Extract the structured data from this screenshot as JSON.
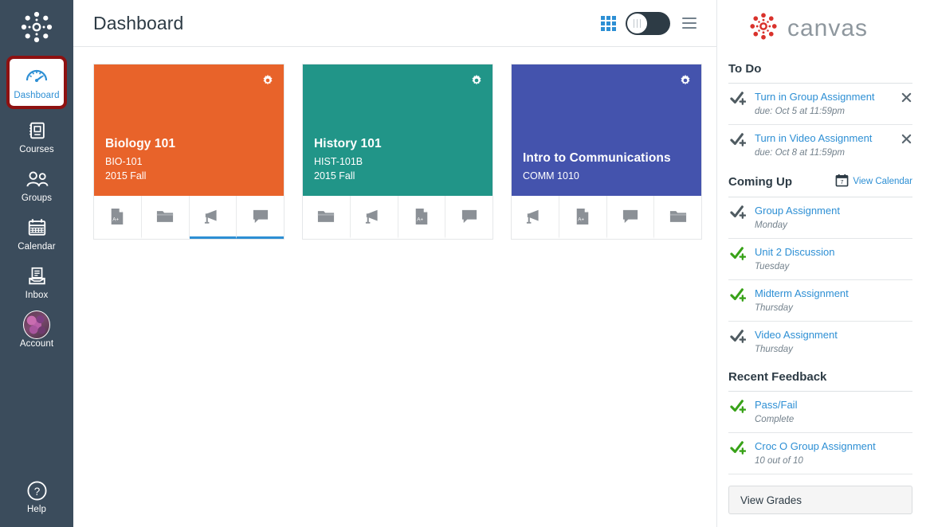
{
  "globalnav": {
    "logo_icon": "canvas-logo-icon",
    "items": [
      {
        "label": "Dashboard",
        "icon": "dashboard-gauge-icon",
        "active": true
      },
      {
        "label": "Courses",
        "icon": "courses-book-icon",
        "active": false
      },
      {
        "label": "Groups",
        "icon": "groups-people-icon",
        "active": false
      },
      {
        "label": "Calendar",
        "icon": "calendar-icon",
        "active": false
      },
      {
        "label": "Inbox",
        "icon": "inbox-tray-icon",
        "active": false
      },
      {
        "label": "Account",
        "icon": "account-avatar-icon",
        "active": false
      }
    ],
    "help": {
      "label": "Help",
      "icon": "help-question-icon"
    },
    "active_highlight_color": "#8E1111",
    "background_color": "#3B4C5C",
    "active_text_color": "#2D8FD4"
  },
  "header": {
    "title": "Dashboard",
    "grid_icon": "grid-view-icon",
    "toggle_icon": "list-view-toggle",
    "menu_icon": "hamburger-menu-icon",
    "grid_icon_color": "#2D8FD4"
  },
  "cards": [
    {
      "name": "Biology 101",
      "code": "BIO-101",
      "term": "2015 Fall",
      "color": "#E8632A",
      "gear_icon": "gear-icon",
      "actions": [
        {
          "icon": "assignments-icon",
          "active": false
        },
        {
          "icon": "files-folder-icon",
          "active": false
        },
        {
          "icon": "announcements-megaphone-icon",
          "active": true
        },
        {
          "icon": "discussions-icon",
          "active": true
        }
      ]
    },
    {
      "name": "History 101",
      "code": "HIST-101B",
      "term": "2015 Fall",
      "color": "#219588",
      "gear_icon": "gear-icon",
      "actions": [
        {
          "icon": "files-folder-icon",
          "active": false
        },
        {
          "icon": "announcements-megaphone-icon",
          "active": false
        },
        {
          "icon": "assignments-icon",
          "active": false
        },
        {
          "icon": "discussions-icon",
          "active": false
        }
      ]
    },
    {
      "name": "Intro to Communications",
      "code": "COMM 1010",
      "term": "",
      "color": "#4453AD",
      "gear_icon": "gear-icon",
      "actions": [
        {
          "icon": "announcements-megaphone-icon",
          "active": false
        },
        {
          "icon": "assignments-icon",
          "active": false
        },
        {
          "icon": "discussions-icon",
          "active": false
        },
        {
          "icon": "files-folder-icon",
          "active": false
        }
      ]
    }
  ],
  "rail": {
    "brand": {
      "word": "canvas",
      "logo_icon": "canvas-logo-icon",
      "word_color": "#8E979E",
      "logo_color": "#D9322C"
    },
    "todo": {
      "title": "To Do",
      "items": [
        {
          "link": "Turn in Group Assignment",
          "sub": "due: Oct 5 at 11:59pm",
          "icon": "assignment-check-icon",
          "icon_color": "#4F5B61",
          "close_icon": "close-icon"
        },
        {
          "link": "Turn in Video Assignment",
          "sub": "due: Oct 8 at 11:59pm",
          "icon": "assignment-check-icon",
          "icon_color": "#4F5B61",
          "close_icon": "close-icon"
        }
      ]
    },
    "coming_up": {
      "title": "Coming Up",
      "view_calendar_label": "View Calendar",
      "calendar_icon": "calendar-icon",
      "calendar_icon_day": "7",
      "items": [
        {
          "link": "Group Assignment",
          "sub": "Monday",
          "icon": "assignment-check-icon",
          "icon_color": "#4F5B61"
        },
        {
          "link": "Unit 2 Discussion",
          "sub": "Tuesday",
          "icon": "assignment-check-icon",
          "icon_color": "#38A218"
        },
        {
          "link": "Midterm Assignment",
          "sub": "Thursday",
          "icon": "assignment-check-icon",
          "icon_color": "#38A218"
        },
        {
          "link": "Video Assignment",
          "sub": "Thursday",
          "icon": "assignment-check-icon",
          "icon_color": "#4F5B61"
        }
      ]
    },
    "recent_feedback": {
      "title": "Recent Feedback",
      "items": [
        {
          "link": "Pass/Fail",
          "sub": "Complete",
          "icon": "assignment-check-icon",
          "icon_color": "#38A218"
        },
        {
          "link": "Croc O Group Assignment",
          "sub": "10 out of 10",
          "icon": "assignment-check-icon",
          "icon_color": "#38A218"
        }
      ],
      "view_grades_label": "View Grades"
    },
    "link_color": "#2D8FD4"
  }
}
